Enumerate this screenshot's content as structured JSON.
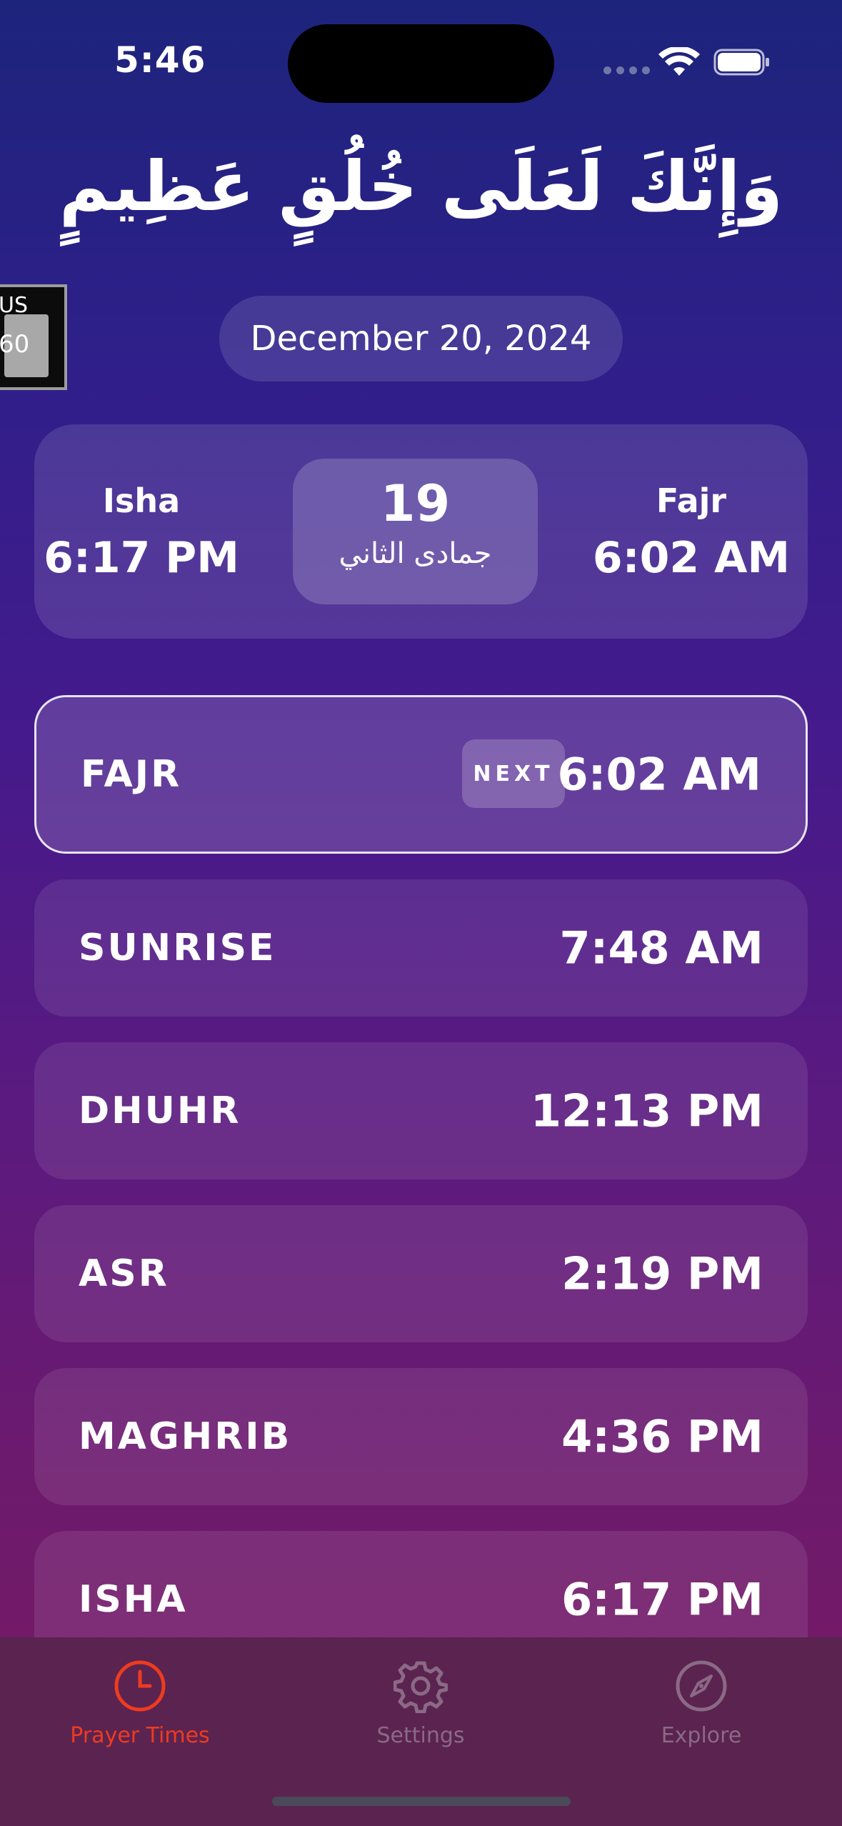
{
  "status_bar": {
    "time": "5:46"
  },
  "header": {
    "arabic_title": "وَإِنَّكَ لَعَلَى خُلُقٍ عَظِيمٍ"
  },
  "widget": {
    "top_text": "US",
    "bottom_text": "60"
  },
  "date": "December 20, 2024",
  "summary": {
    "prev": {
      "name": "Isha",
      "time": "6:17 PM"
    },
    "hijri": {
      "day": "19",
      "month": "جمادى الثاني"
    },
    "next": {
      "name": "Fajr",
      "time": "6:02 AM"
    }
  },
  "prayers": [
    {
      "name": "FAJR",
      "time": "6:02 AM",
      "badge": "NEXT"
    },
    {
      "name": "SUNRISE",
      "time": "7:48 AM"
    },
    {
      "name": "DHUHR",
      "time": "12:13 PM"
    },
    {
      "name": "ASR",
      "time": "2:19 PM"
    },
    {
      "name": "MAGHRIB",
      "time": "4:36 PM"
    },
    {
      "name": "ISHA",
      "time": "6:17 PM"
    }
  ],
  "tabs": [
    {
      "label": "Prayer Times",
      "icon": "clock-icon",
      "active": true
    },
    {
      "label": "Settings",
      "icon": "gear-icon",
      "active": false
    },
    {
      "label": "Explore",
      "icon": "compass-icon",
      "active": false
    }
  ],
  "colors": {
    "active_tab": "#ee3b1f",
    "inactive_tab": "#8a6a86"
  }
}
